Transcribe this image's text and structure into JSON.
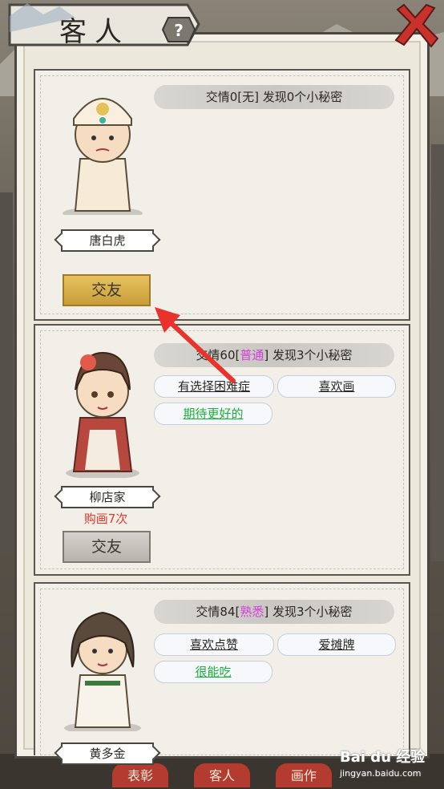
{
  "header": {
    "title": "客人",
    "help_icon": "question-icon",
    "close_icon": "close-x-icon"
  },
  "cards": [
    {
      "name": "唐白虎",
      "stat_prefix": "交情0[",
      "level": "无",
      "stat_suffix": "] 发现0个小秘密",
      "purchase": "",
      "button": "交友",
      "secrets": []
    },
    {
      "name": "柳店家",
      "stat_prefix": "交情60[",
      "level": "普通",
      "stat_suffix": "] 发现3个小秘密",
      "purchase": "购画7次",
      "button": "交友",
      "secrets": [
        "有选择困难症",
        "喜欢画",
        "期待更好的"
      ]
    },
    {
      "name": "黄多金",
      "stat_prefix": "交情84[",
      "level": "熟悉",
      "stat_suffix": "] 发现3个小秘密",
      "purchase": "",
      "button": "",
      "secrets": [
        "喜欢点赞",
        "爱摊牌",
        "很能吃"
      ]
    }
  ],
  "bottom_tabs": [
    "表彰",
    "客人",
    "画作"
  ],
  "watermark": {
    "brand": "Bai du 经验",
    "url": "jingyan.baidu.com"
  },
  "colors": {
    "gold_button": "#d9b24c",
    "level_purple": "#d23fd8",
    "secret_green": "#19b13a",
    "purchase_red": "#e03a2e",
    "arrow_red": "#e8322b"
  }
}
